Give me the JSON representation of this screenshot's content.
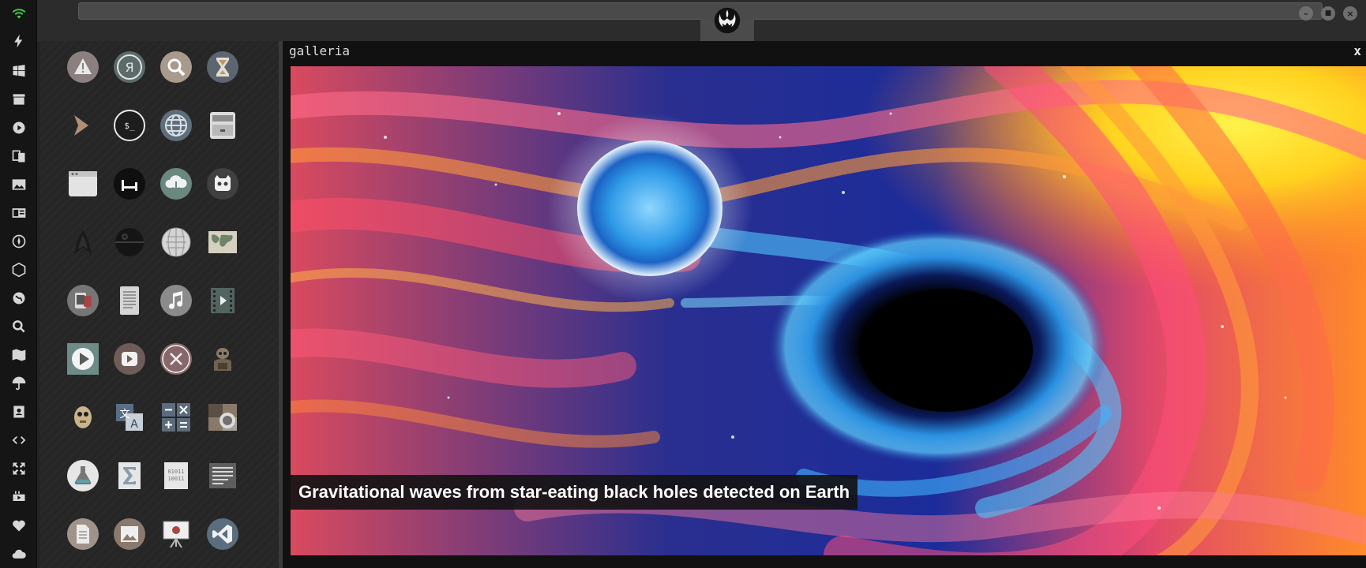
{
  "viewer": {
    "title": "galleria",
    "close_label": "x",
    "caption": "Gravitational waves from star-eating black holes detected on Earth"
  },
  "window_controls": {
    "minimize": "–",
    "maximize": "■",
    "close": "×"
  },
  "dock": {
    "icons": [
      "wifi-icon",
      "bolt-icon",
      "windows-icon",
      "archive-icon",
      "play-icon",
      "translate-icon",
      "image-icon",
      "news-icon",
      "rebel-icon",
      "empire-icon",
      "globe-icon",
      "search-icon",
      "map-icon",
      "umbrella-icon",
      "contacts-icon",
      "code-icon",
      "expand-icon",
      "youtube-icon",
      "heart-icon",
      "cloud-icon"
    ]
  },
  "launcher": {
    "apps": [
      [
        "warning-app-icon",
        "yandex-app-icon",
        "search-app-icon",
        "hourglass-app-icon"
      ],
      [
        "chevron-app-icon",
        "terminal-app-icon",
        "globe-app-icon",
        "drive-app-icon"
      ],
      [
        "window-app-icon",
        "bed-app-icon",
        "cloud-download-app-icon",
        "robot-app-icon"
      ],
      [
        "starfleet-app-icon",
        "death-star-app-icon",
        "wikipedia-app-icon",
        "world-map-app-icon"
      ],
      [
        "devices-app-icon",
        "document-reader-app-icon",
        "music-app-icon",
        "video-app-icon"
      ],
      [
        "play-app-icon",
        "video-player-app-icon",
        "close-app-icon",
        "droid-app-icon"
      ],
      [
        "c3po-app-icon",
        "translate-app-icon",
        "calculator-app-icon",
        "camera-app-icon"
      ],
      [
        "flask-app-icon",
        "sigma-app-icon",
        "binary-app-icon",
        "text-editor-app-icon"
      ],
      [
        "document-app-icon",
        "photo-app-icon",
        "presentation-app-icon",
        "vscode-app-icon"
      ]
    ]
  },
  "colors": {
    "dock_bg": "#151515",
    "launcher_bg": "#262626",
    "caption_bg": "#141414",
    "icon_gray": "#d6d6d6"
  }
}
